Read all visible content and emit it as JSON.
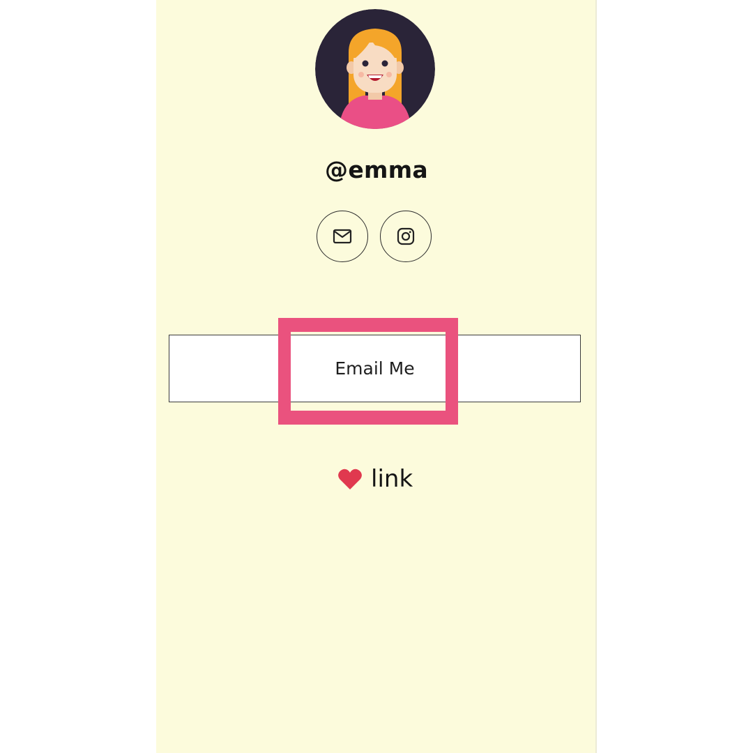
{
  "profile": {
    "handle": "@emma",
    "avatar_icon": "girl-avatar-icon"
  },
  "social_links": [
    {
      "icon": "mail-icon"
    },
    {
      "icon": "instagram-icon"
    }
  ],
  "links": [
    {
      "label": "Email Me"
    }
  ],
  "footer": {
    "icon": "heart-icon",
    "label": "link"
  },
  "colors": {
    "panel_background": "#fcfbdc",
    "highlight": "#ea527e",
    "heart": "#e0394f",
    "avatar_background": "#2a2438",
    "avatar_shirt": "#ea4f86",
    "avatar_hair": "#f4a52a"
  }
}
